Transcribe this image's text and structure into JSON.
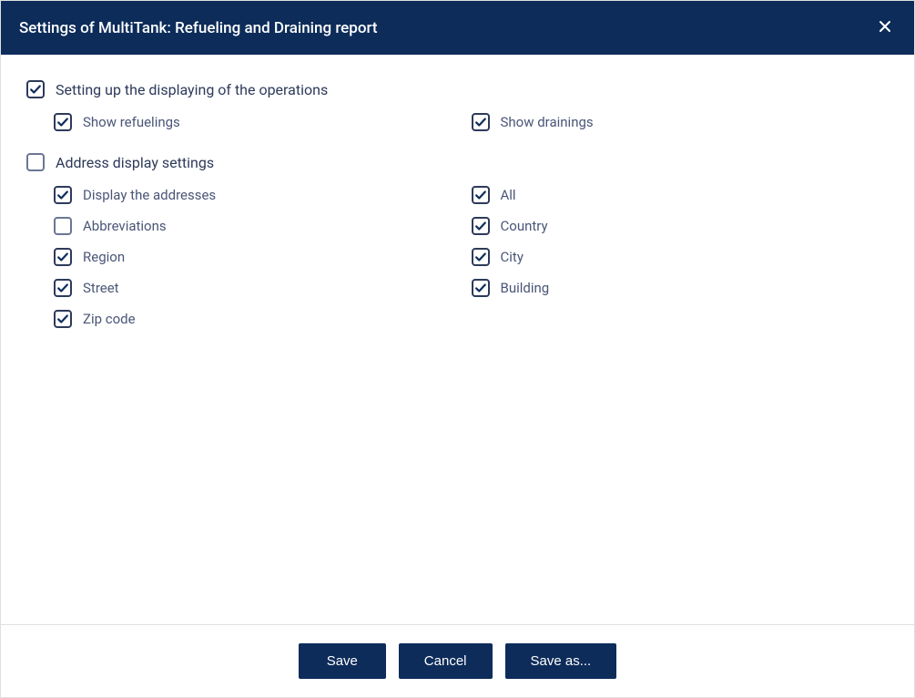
{
  "dialog": {
    "title": "Settings of MultiTank: Refueling and Draining report"
  },
  "sections": {
    "operations": {
      "label": "Setting up the displaying of the operations",
      "checked": true,
      "options": {
        "refuelings": {
          "label": "Show refuelings",
          "checked": true
        },
        "drainings": {
          "label": "Show drainings",
          "checked": true
        }
      }
    },
    "address": {
      "label": "Address display settings",
      "checked": false,
      "options": {
        "display_addresses": {
          "label": "Display the addresses",
          "checked": true
        },
        "abbreviations": {
          "label": "Abbreviations",
          "checked": false
        },
        "region": {
          "label": "Region",
          "checked": true
        },
        "street": {
          "label": "Street",
          "checked": true
        },
        "zip_code": {
          "label": "Zip code",
          "checked": true
        },
        "all": {
          "label": "All",
          "checked": true
        },
        "country": {
          "label": "Country",
          "checked": true
        },
        "city": {
          "label": "City",
          "checked": true
        },
        "building": {
          "label": "Building",
          "checked": true
        }
      }
    }
  },
  "buttons": {
    "save": "Save",
    "cancel": "Cancel",
    "save_as": "Save as..."
  }
}
